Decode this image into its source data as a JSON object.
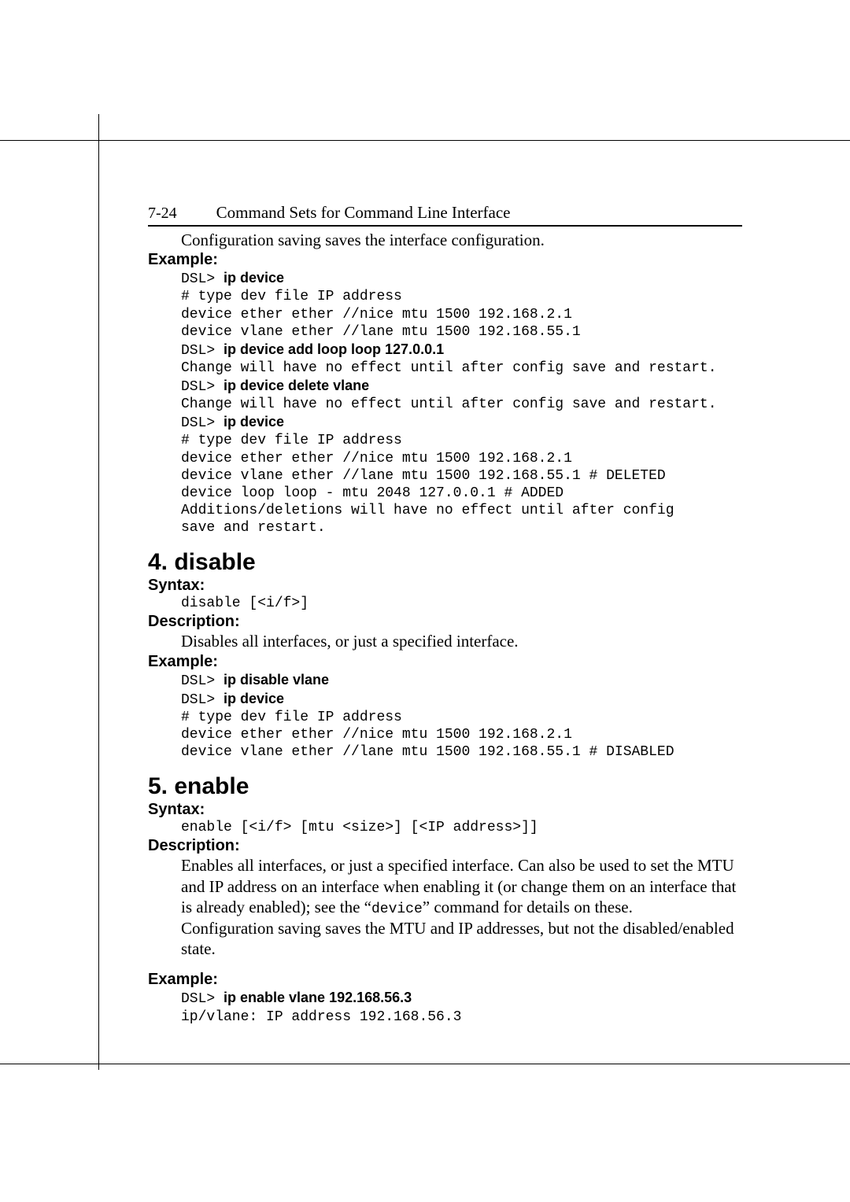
{
  "pageNumber": "7-24",
  "chapterTitle": "Command Sets for Command Line Interface",
  "intro": "Configuration saving saves the interface configuration.",
  "labels": {
    "example": "Example:",
    "syntax": "Syntax:",
    "description": "Description:"
  },
  "block1": {
    "l1p": "DSL> ",
    "l1c": "ip device",
    "l2": "# type dev file IP address",
    "l3": "device ether ether //nice mtu 1500 192.168.2.1",
    "l4": "device vlane ether //lane mtu 1500 192.168.55.1",
    "l5p": "DSL> ",
    "l5c": "ip device add loop loop 127.0.0.1",
    "l6": "Change will have no effect until after config save and restart.",
    "l7p": "DSL> ",
    "l7c": "ip device delete vlane",
    "l8": "Change will have no effect until after config save and restart.",
    "l9p": "DSL> ",
    "l9c": "ip device",
    "l10": "# type dev file IP address",
    "l11": "device ether ether //nice mtu 1500 192.168.2.1",
    "l12": "device vlane ether //lane mtu 1500 192.168.55.1 # DELETED",
    "l13": "device loop loop - mtu 2048 127.0.0.1 # ADDED",
    "l14": "Additions/deletions will have no effect until after config",
    "l15": "save and restart."
  },
  "section4": {
    "title": "4.  disable",
    "syntax": "disable [<i/f>]",
    "desc": "Disables all interfaces, or just a specified interface.",
    "ex": {
      "l1p": "DSL> ",
      "l1c": "ip disable vlane",
      "l2p": "DSL> ",
      "l2c": "ip device",
      "l3": "# type dev file IP address",
      "l4": "device ether ether //nice mtu 1500 192.168.2.1",
      "l5": "device vlane ether //lane mtu 1500 192.168.55.1 # DISABLED"
    }
  },
  "section5": {
    "title": "5.  enable",
    "syntax": "enable [<i/f> [mtu <size>] [<IP address>]]",
    "desc1": "Enables all interfaces, or just a specified interface. Can also be used to set the MTU and IP address on an interface when enabling it (or change them on an interface that is already enabled); see the “",
    "descCode": "device",
    "desc1b": "” command for details on these.",
    "desc2": "Configuration saving saves the MTU and IP addresses, but not the disabled/enabled state.",
    "ex": {
      "l1p": "DSL> ",
      "l1c": "ip enable vlane 192.168.56.3",
      "l2": "ip/vlane: IP address 192.168.56.3"
    }
  }
}
